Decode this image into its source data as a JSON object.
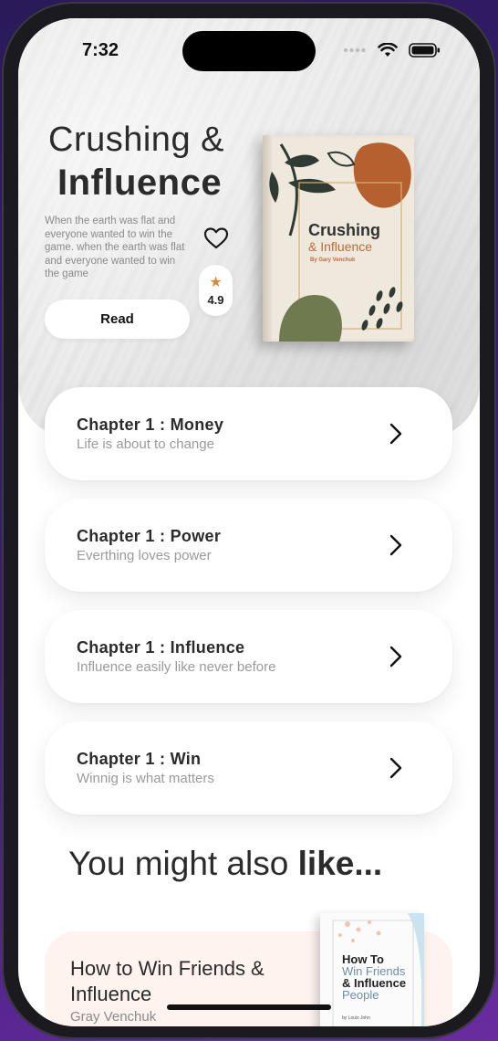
{
  "status_bar": {
    "time": "7:32"
  },
  "hero": {
    "title_line1": "Crushing &",
    "title_line2": "Influence",
    "description": "When the earth was flat and everyone wanted to win the game. when the earth was flat and everyone wanted to win the game",
    "rating": "4.9",
    "read_label": "Read",
    "book_cover": {
      "title": "Crushing",
      "subtitle": "& Influence",
      "author": "By Gary Venchuk"
    }
  },
  "chapters": [
    {
      "title": "Chapter 1 : Money",
      "subtitle": "Life is about to change"
    },
    {
      "title": "Chapter 1 : Power",
      "subtitle": "Everthing loves power"
    },
    {
      "title": "Chapter 1 : Influence",
      "subtitle": "Influence easily like never before"
    },
    {
      "title": "Chapter 1 : Win",
      "subtitle": "Winnig is what matters"
    }
  ],
  "also_like": {
    "prefix": "You might also ",
    "bold": "like..."
  },
  "recommendation": {
    "title": "How to Win Friends & Influence",
    "author": "Gray Venchuk",
    "cover": {
      "line1": "How To",
      "line2": "Win Friends",
      "line3": "& Influence",
      "line4": "People",
      "author": "by Louis John"
    }
  },
  "colors": {
    "accent_star": "#d98a3c",
    "book_orange": "#c06a36",
    "book_green": "#6f7a4f",
    "rec_card_bg": "#fff3f0"
  },
  "icons": [
    "heart-icon",
    "star-icon",
    "chevron-right-icon",
    "wifi-icon",
    "battery-icon",
    "signal-icon"
  ]
}
